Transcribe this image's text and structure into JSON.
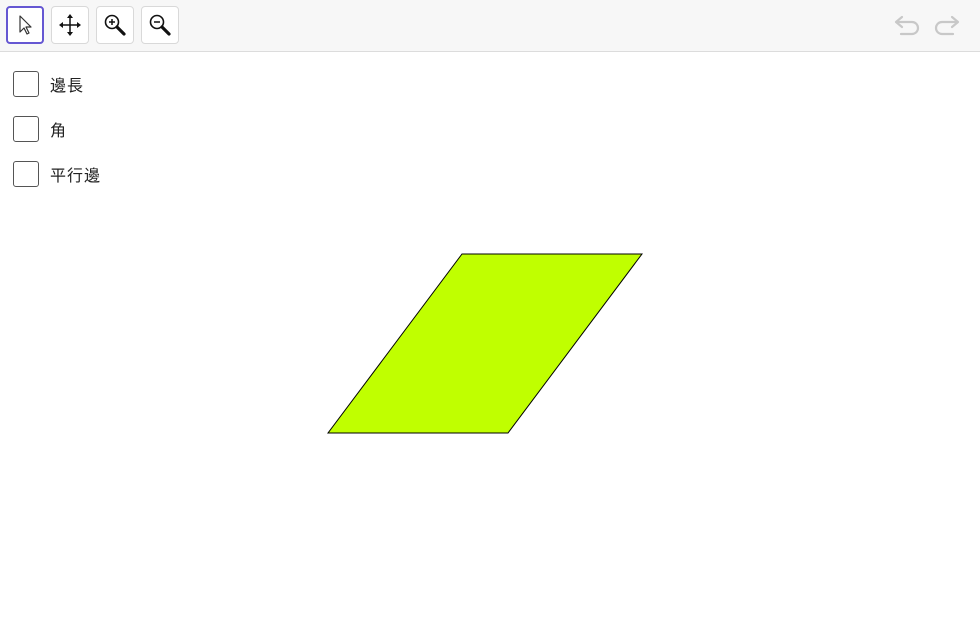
{
  "toolbar": {
    "tools": [
      {
        "icon": "pointer-arrow-icon",
        "selected": true
      },
      {
        "icon": "move-arrows-icon",
        "selected": false
      },
      {
        "icon": "zoom-in-icon",
        "selected": false
      },
      {
        "icon": "zoom-out-icon",
        "selected": false
      }
    ],
    "undo_icon": "undo-icon",
    "redo_icon": "redo-icon",
    "selected_color": "#6557d2"
  },
  "checkboxes": [
    {
      "label": "邊長",
      "checked": false
    },
    {
      "label": "角",
      "checked": false
    },
    {
      "label": "平行邊",
      "checked": false
    }
  ],
  "shape": {
    "type": "parallelogram",
    "fill": "#c0ff00",
    "stroke": "#000000"
  }
}
